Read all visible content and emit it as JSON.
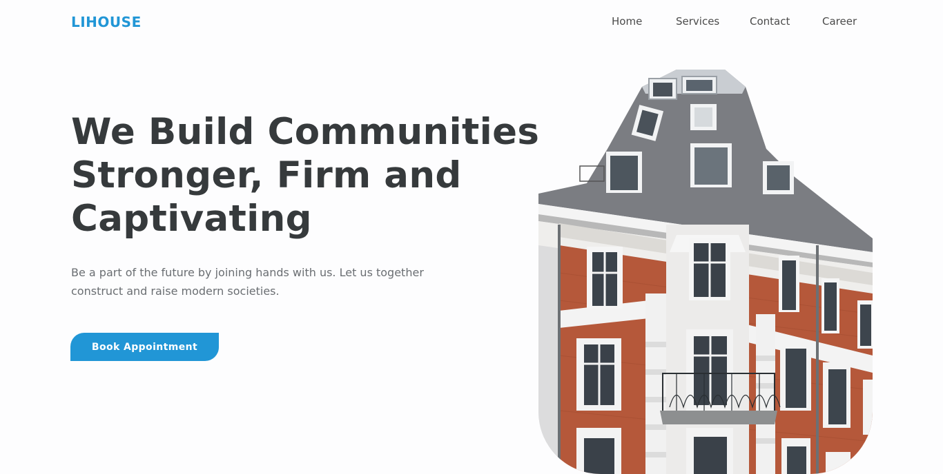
{
  "header": {
    "logo": "LIHOUSE",
    "nav": {
      "home": "Home",
      "services": "Services",
      "contact": "Contact",
      "career": "Career"
    }
  },
  "hero": {
    "title": "We Build Communities\nStronger, Firm and\nCaptivating",
    "description": "Be a part of the future by joining hands with us. Let us together construct and raise modern societies.",
    "cta_label": "Book Appointment"
  },
  "colors": {
    "accent": "#2196d6",
    "heading": "#363a3c",
    "body_text": "#6a6e72"
  },
  "image": {
    "subject": "building-photo"
  }
}
